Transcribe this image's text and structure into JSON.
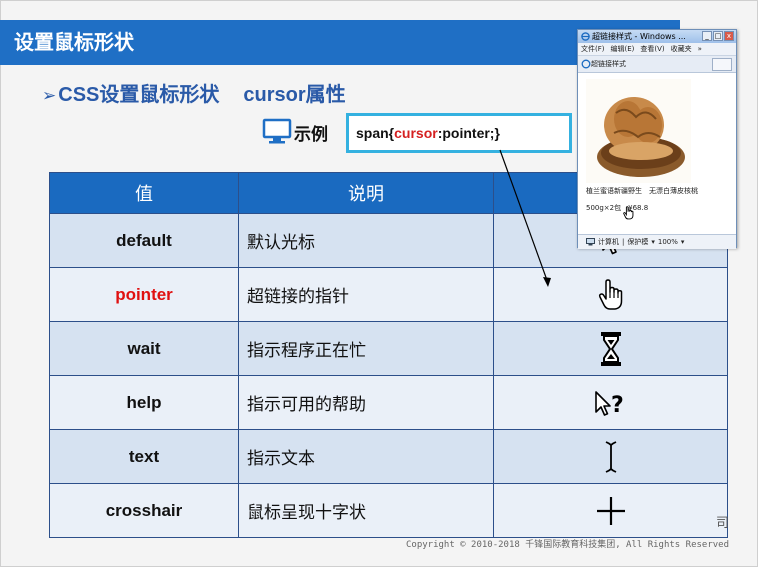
{
  "slide": {
    "title": "设置鼠标形状",
    "subtitle_arrow": "➢",
    "subtitle_main": "CSS设置鼠标形状",
    "subtitle_property": "cursor属性",
    "example_label": "示例",
    "code": {
      "selector": "span{",
      "property": "cursor",
      "rest": ":pointer;}"
    }
  },
  "table": {
    "headers": [
      "值",
      "说明",
      ""
    ],
    "rows": [
      {
        "value": "default",
        "description": "默认光标",
        "cursor_icon": "arrow-cursor-icon",
        "highlight": false
      },
      {
        "value": "pointer",
        "description": "超链接的指针",
        "cursor_icon": "hand-pointer-cursor-icon",
        "highlight": true,
        "highlight_color": "#e01010"
      },
      {
        "value": "wait",
        "description": "指示程序正在忙",
        "cursor_icon": "hourglass-cursor-icon",
        "highlight": false
      },
      {
        "value": "help",
        "description": "指示可用的帮助",
        "cursor_icon": "help-cursor-icon",
        "highlight": false
      },
      {
        "value": "text",
        "description": "指示文本",
        "cursor_icon": "text-cursor-icon",
        "highlight": false
      },
      {
        "value": "crosshair",
        "description": "鼠标呈现十字状",
        "cursor_icon": "crosshair-cursor-icon",
        "highlight": false
      }
    ]
  },
  "browser_window": {
    "title": "超链接样式 - Windows ...",
    "controls": [
      "_",
      "□",
      "x"
    ],
    "menu": [
      "文件(F)",
      "编辑(E)",
      "查看(V)",
      "收藏夹",
      "»"
    ],
    "tab_label": "超链接样式",
    "product_name": "植兰蜜语新疆野生　无漂白薄皮核桃",
    "product_price": "500g×2包　¥68.8",
    "status": [
      "计算机",
      "|",
      "保护模",
      "▾",
      "100%",
      "▾"
    ]
  },
  "footer": {
    "company": "司",
    "copyright": "Copyright © 2010-2018 千锋国际教育科技集团, All Rights Reserved"
  },
  "colors": {
    "title_bar": "#1f6fc5",
    "table_header": "#1a6ac0",
    "accent_red": "#e01010",
    "code_border": "#34b1e0"
  }
}
